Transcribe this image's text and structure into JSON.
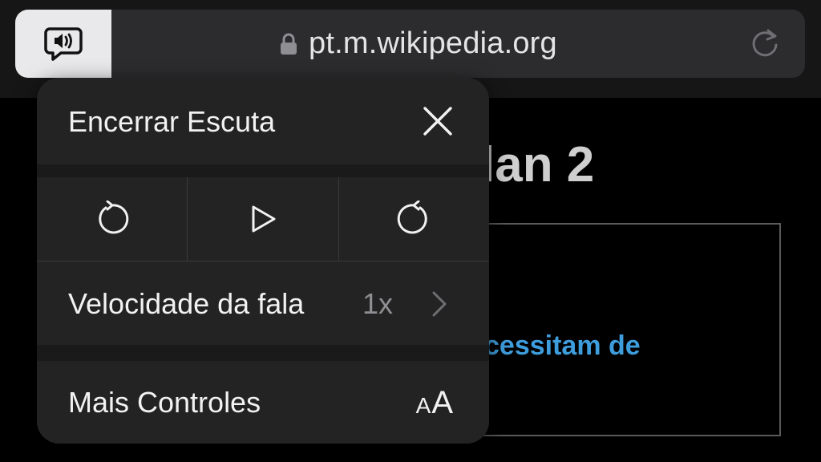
{
  "browser": {
    "url": "pt.m.wikipedia.org",
    "icons": {
      "listen": "speaker-bubble-icon",
      "lock": "lock-icon",
      "reload": "reload-icon"
    }
  },
  "page_background": {
    "heading_fragment": "lan 2",
    "link_fragment": "cessitam de"
  },
  "listen_popover": {
    "title": "Encerrar Escuta",
    "controls": [
      {
        "name": "skip-back",
        "icon": "rewind-circle-icon"
      },
      {
        "name": "play",
        "icon": "play-icon"
      },
      {
        "name": "skip-forward",
        "icon": "forward-circle-icon"
      }
    ],
    "speed_label": "Velocidade da fala",
    "speed_value": "1x",
    "more_label": "Mais Controles",
    "text_size_glyph_small": "A",
    "text_size_glyph_large": "A"
  },
  "colors": {
    "popover_bg": "#2a2a2a",
    "link_blue": "#3e9ddd",
    "secondary_text": "#8e8e93"
  }
}
